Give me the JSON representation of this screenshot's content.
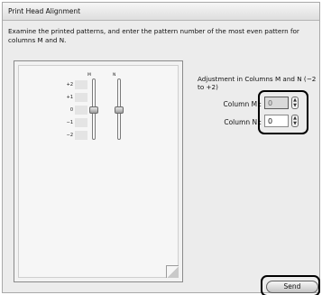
{
  "window": {
    "title": "Print Head Alignment"
  },
  "instruction": "Examine the printed patterns, and enter the pattern number of the most even pattern for columns M and N.",
  "pattern_panel": {
    "columns": [
      "M",
      "N"
    ],
    "rows": [
      "+2",
      "+1",
      "0",
      "−1",
      "−2"
    ],
    "sliders": [
      {
        "column": "M",
        "value": 0
      },
      {
        "column": "N",
        "value": 0
      }
    ]
  },
  "adjustment": {
    "label": "Adjustment in Columns M and N (−2 to +2)",
    "column_m": {
      "label": "Column M :",
      "value": "0"
    },
    "column_n": {
      "label": "Column N :",
      "value": "0"
    }
  },
  "send_button": {
    "label": "Send"
  },
  "icons": {
    "stepper_up": "up-arrow-icon",
    "stepper_down": "down-arrow-icon"
  }
}
